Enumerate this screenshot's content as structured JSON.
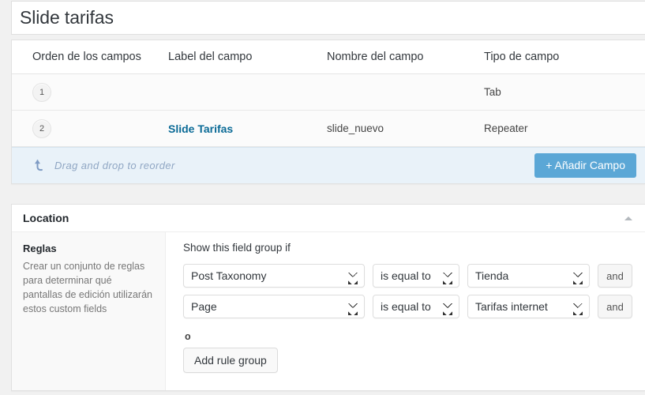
{
  "page": {
    "title": "Slide tarifas"
  },
  "fields_panel": {
    "columns": [
      "Orden de los campos",
      "Label del campo",
      "Nombre del campo",
      "Tipo de campo"
    ],
    "rows": [
      {
        "order": "1",
        "label": "",
        "name": "",
        "type": "Tab"
      },
      {
        "order": "2",
        "label": "Slide Tarifas",
        "name": "slide_nuevo",
        "type": "Repeater"
      }
    ],
    "footer": {
      "drag_hint": "Drag and drop to reorder",
      "drag_icon": "curved-arrow-up-left-icon",
      "add_field_label": "+ Añadir Campo",
      "add_field_color": "#5ba7d6"
    }
  },
  "location_panel": {
    "title": "Location",
    "collapse_icon": "triangle-up-icon",
    "sidebar": {
      "heading": "Reglas",
      "description": "Crear un conjunto de reglas para determinar qué pantallas de edición utilizarán estos custom fields"
    },
    "main": {
      "show_if_label": "Show this field group if",
      "rules": [
        {
          "param": "Post Taxonomy",
          "operator": "is equal to",
          "value": "Tienda",
          "and_label": "and"
        },
        {
          "param": "Page",
          "operator": "is equal to",
          "value": "Tarifas internet",
          "and_label": "and"
        }
      ],
      "or_separator": "o",
      "add_rule_group_label": "Add rule group"
    }
  }
}
